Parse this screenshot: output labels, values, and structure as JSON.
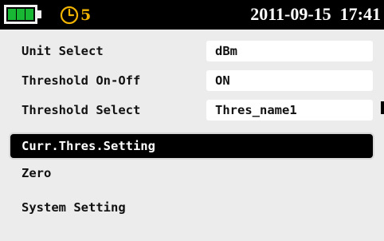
{
  "status_bar": {
    "battery_level": "3/3",
    "battery_color": "#18b834",
    "timer_icon": "clock-icon",
    "timer_count": "5",
    "timer_color": "#f0b400",
    "date": "2011-09-15",
    "time": "17:41"
  },
  "menu": {
    "items": [
      {
        "label": "Unit Select",
        "value": "dBm"
      },
      {
        "label": "Threshold On-Off",
        "value": "ON"
      },
      {
        "label": "Threshold Select",
        "value": "Thres_name1"
      },
      {
        "label": "Curr.Thres.Setting",
        "selected": true
      },
      {
        "label": "Zero"
      },
      {
        "label": "System Setting"
      }
    ],
    "selected_background": "#000000"
  }
}
